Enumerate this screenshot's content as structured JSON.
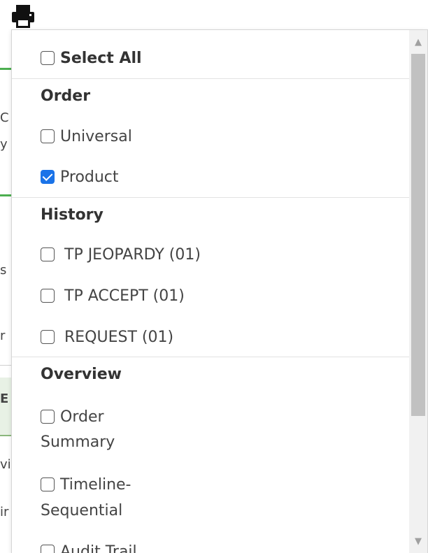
{
  "background": {
    "fragments": [
      "C",
      "y",
      "s",
      "r",
      "E",
      "vi",
      "ir"
    ]
  },
  "toolbar": {
    "print_icon": "printer-icon"
  },
  "dropdown": {
    "select_all": {
      "label": "Select All",
      "checked": false
    },
    "sections": [
      {
        "heading": "Order",
        "items": [
          {
            "label": "Universal",
            "checked": false
          },
          {
            "label": "Product",
            "checked": true
          }
        ]
      },
      {
        "heading": "History",
        "items": [
          {
            "label": "TP JEOPARDY (01)",
            "checked": false
          },
          {
            "label": "TP ACCEPT (01)",
            "checked": false
          },
          {
            "label": "REQUEST (01)",
            "checked": false
          }
        ]
      },
      {
        "heading": "Overview",
        "items": [
          {
            "label_line1": "Order",
            "label_line2": "Summary",
            "checked": false
          },
          {
            "label_line1": "Timeline-",
            "label_line2": "Sequential",
            "checked": false
          },
          {
            "label": "Audit Trail",
            "checked": false
          }
        ]
      }
    ]
  },
  "scrollbar": {
    "up_icon": "arrow-up-icon",
    "down_icon": "arrow-down-icon"
  },
  "colors": {
    "checkbox_checked": "#1a73e8",
    "scroll_thumb": "#c1c1c1",
    "accent_green": "#4caf50"
  }
}
